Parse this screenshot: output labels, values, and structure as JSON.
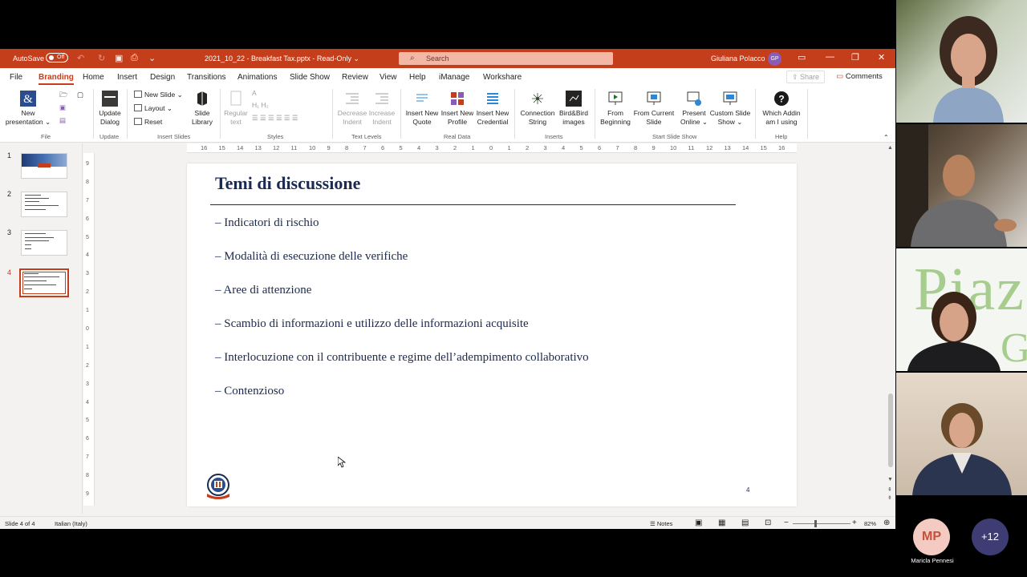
{
  "titlebar": {
    "autosave_label": "AutoSave",
    "autosave_state": "Off",
    "document_title": "2021_10_22 - Breakfast Tax.pptx  -  Read-Only  ⌄",
    "search_placeholder": "Search",
    "user_name": "Giuliana Polacco",
    "user_initials": "GP",
    "accent_color": "#c43e1c"
  },
  "menu": {
    "tabs": [
      "File",
      "Branding",
      "Home",
      "Insert",
      "Design",
      "Transitions",
      "Animations",
      "Slide Show",
      "Review",
      "View",
      "Help",
      "iManage",
      "Workshare"
    ],
    "active_tab": "Branding",
    "share_label": "Share",
    "comments_label": "Comments"
  },
  "ribbon": {
    "file_group": {
      "new_presentation": "New presentation ⌄",
      "label": "File"
    },
    "update_group": {
      "update_dialog": "Update Dialog",
      "label": "Update"
    },
    "insert_slides_group": {
      "new_slide": "New Slide",
      "layout": "Layout ⌄",
      "reset": "Reset",
      "slide_library": "Slide Library",
      "label": "Insert Slides"
    },
    "styles_group": {
      "regular_text": "Regular text",
      "label": "Styles"
    },
    "text_levels_group": {
      "decrease_indent": "Decrease Indent",
      "increase_indent": "Increase Indent",
      "label": "Text Levels"
    },
    "real_data_group": {
      "insert_new_quote": "Insert New Quote",
      "insert_new_profile": "Insert New Profile",
      "insert_new_credential": "Insert New Credential",
      "label": "Real Data"
    },
    "inserts_group": {
      "connection_string": "Connection String",
      "bird_images": "Bird&Bird images",
      "label": "Inserts"
    },
    "start_slide_show_group": {
      "from_beginning": "From Beginning",
      "from_current_slide": "From Current Slide",
      "present_online": "Present Online ⌄",
      "custom_slide_show": "Custom Slide Show ⌄",
      "label": "Start Slide Show"
    },
    "help_group": {
      "which_addin": "Which Addin am I using",
      "label": "Help"
    }
  },
  "ruler": {
    "horizontal": [
      "16",
      "15",
      "14",
      "13",
      "12",
      "11",
      "10",
      "9",
      "8",
      "7",
      "6",
      "5",
      "4",
      "3",
      "2",
      "1",
      "0",
      "1",
      "2",
      "3",
      "4",
      "5",
      "6",
      "7",
      "8",
      "9",
      "10",
      "11",
      "12",
      "13",
      "14",
      "15",
      "16"
    ],
    "vertical": [
      "9",
      "8",
      "7",
      "6",
      "5",
      "4",
      "3",
      "2",
      "1",
      "0",
      "1",
      "2",
      "3",
      "4",
      "5",
      "6",
      "7",
      "8",
      "9"
    ]
  },
  "thumbnails": [
    {
      "number": "1"
    },
    {
      "number": "2"
    },
    {
      "number": "3"
    },
    {
      "number": "4",
      "active": true
    }
  ],
  "slide": {
    "title": "Temi di discussione",
    "bullets": [
      "– Indicatori di rischio",
      "– Modalità di esecuzione delle verifiche",
      "– Aree di attenzione",
      "– Scambio di informazioni e utilizzo delle informazioni acquisite",
      "– Interlocuzione con il contribuente e regime dell’adempimento collaborativo",
      "– Contenzioso"
    ],
    "page_number": "4",
    "text_color": "#1b2a4e"
  },
  "statusbar": {
    "slide_info": "Slide 4 of 4",
    "language": "Italian (Italy)",
    "notes_label": "Notes",
    "zoom": "82%"
  },
  "meeting": {
    "participant_initials": "MP",
    "participant_name": "Maricla Pennesi",
    "more_participants": "+12",
    "background_text_1": "Piaz",
    "background_text_2": "G"
  }
}
